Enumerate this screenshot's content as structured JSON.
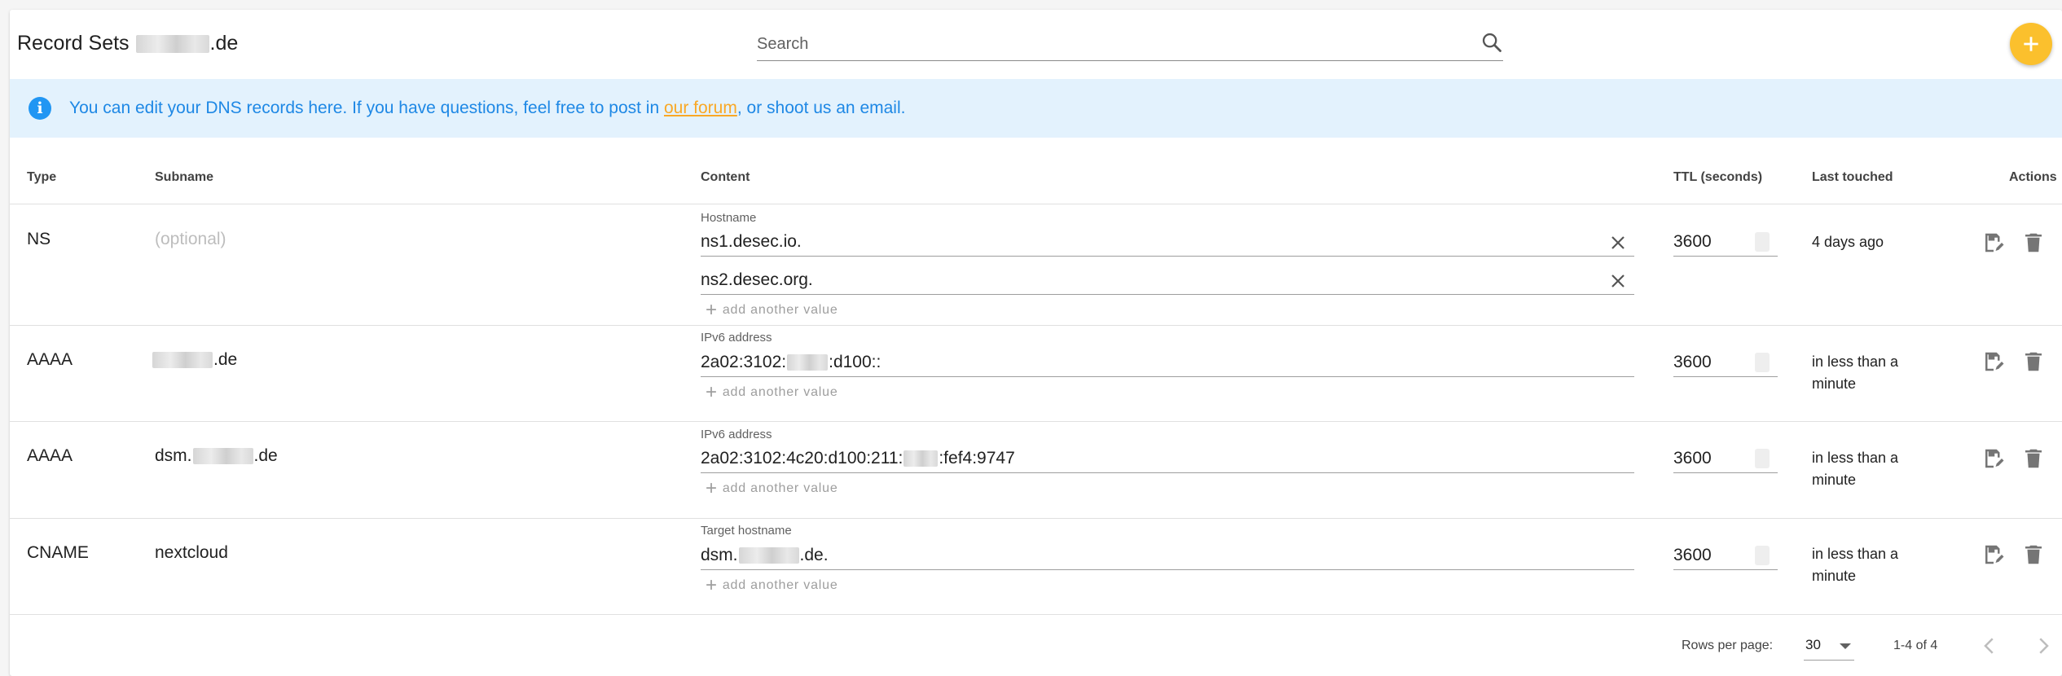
{
  "header": {
    "title_prefix": "Record Sets",
    "title_suffix": ".de",
    "search_placeholder": "Search"
  },
  "alert": {
    "text_before": "You can edit your DNS records here. If you have questions, feel free to post in ",
    "link_text": "our forum",
    "text_after": ", or shoot us an email."
  },
  "columns": {
    "type": "Type",
    "subname": "Subname",
    "content": "Content",
    "ttl": "TTL (seconds)",
    "last_touched": "Last touched",
    "actions": "Actions"
  },
  "add_value_label": "add another value",
  "records": [
    {
      "type": "NS",
      "subname_placeholder": "(optional)",
      "field_label": "Hostname",
      "values": [
        "ns1.desec.io.",
        "ns2.desec.org."
      ],
      "ttl": "3600",
      "last_touched": "4 days ago"
    },
    {
      "type": "AAAA",
      "subname_suffix": ".de",
      "field_label": "IPv6 address",
      "value_prefix": "2a02:3102:",
      "value_suffix": ":d100::",
      "ttl": "3600",
      "last_touched": "in less than a minute"
    },
    {
      "type": "AAAA",
      "subname_prefix": "dsm.",
      "subname_suffix": ".de",
      "field_label": "IPv6 address",
      "value_prefix": "2a02:3102:4c20:d100:211:",
      "value_suffix": ":fef4:9747",
      "ttl": "3600",
      "last_touched": "in less than a minute"
    },
    {
      "type": "CNAME",
      "subname": "nextcloud",
      "field_label": "Target hostname",
      "value_prefix": "dsm.",
      "value_suffix": ".de.",
      "ttl": "3600",
      "last_touched": "in less than a minute"
    }
  ],
  "footer": {
    "rows_per_page_label": "Rows per page:",
    "rows_per_page_value": "30",
    "range_text": "1-4 of 4"
  },
  "colors": {
    "accent": "#fbc02d",
    "info_bg": "#e3f2fd",
    "info_text": "#1e88e5",
    "link": "#f9a825"
  }
}
